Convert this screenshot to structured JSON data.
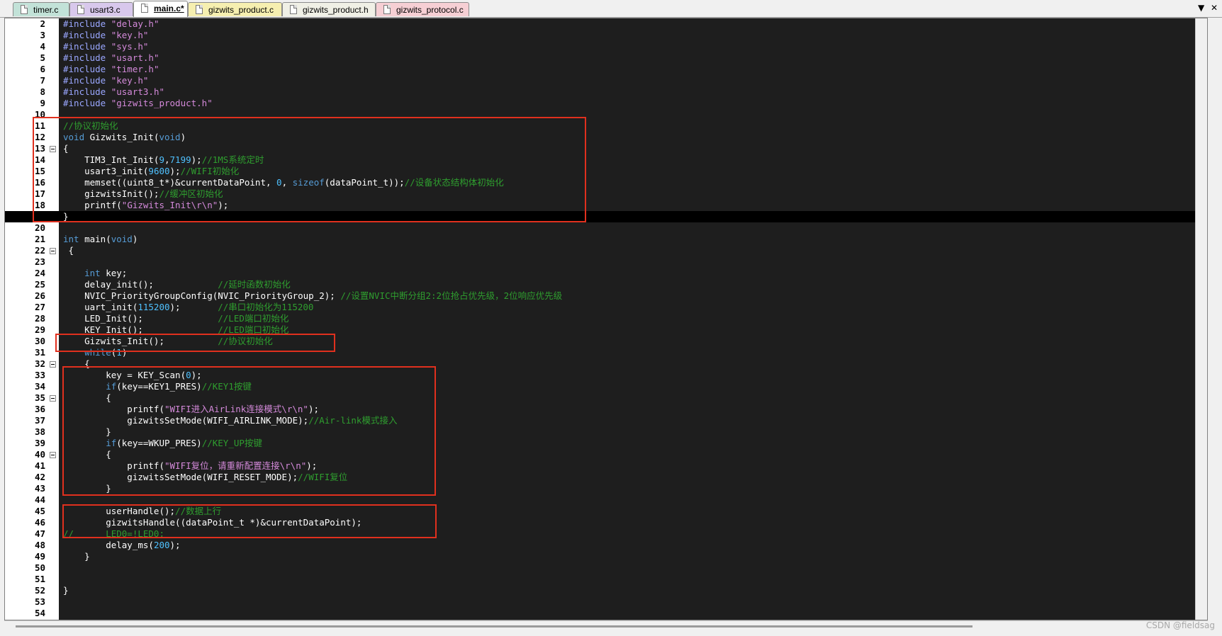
{
  "tabs": [
    {
      "label": "timer.c",
      "color": "#c2e2d8",
      "active": false
    },
    {
      "label": "usart3.c",
      "color": "#d8c8ec",
      "active": false
    },
    {
      "label": "main.c*",
      "color": "#ffffff",
      "active": true
    },
    {
      "label": "gizwits_product.c",
      "color": "#f6efb0",
      "active": false
    },
    {
      "label": "gizwits_product.h",
      "color": "#f0f0e6",
      "active": false
    },
    {
      "label": "gizwits_protocol.c",
      "color": "#f6cfd4",
      "active": false
    }
  ],
  "tab_controls": {
    "dropdown": "▼",
    "close": "✕"
  },
  "code_lines": [
    {
      "n": "2",
      "fold": false,
      "segs": [
        {
          "t": "#include ",
          "c": "pp"
        },
        {
          "t": "\"delay.h\"",
          "c": "str"
        }
      ]
    },
    {
      "n": "3",
      "fold": false,
      "segs": [
        {
          "t": "#include ",
          "c": "pp"
        },
        {
          "t": "\"key.h\"",
          "c": "str"
        }
      ]
    },
    {
      "n": "4",
      "fold": false,
      "segs": [
        {
          "t": "#include ",
          "c": "pp"
        },
        {
          "t": "\"sys.h\"",
          "c": "str"
        }
      ]
    },
    {
      "n": "5",
      "fold": false,
      "segs": [
        {
          "t": "#include ",
          "c": "pp"
        },
        {
          "t": "\"usart.h\"",
          "c": "str"
        }
      ]
    },
    {
      "n": "6",
      "fold": false,
      "segs": [
        {
          "t": "#include ",
          "c": "pp"
        },
        {
          "t": "\"timer.h\"",
          "c": "str"
        }
      ]
    },
    {
      "n": "7",
      "fold": false,
      "segs": [
        {
          "t": "#include ",
          "c": "pp"
        },
        {
          "t": "\"key.h\"",
          "c": "str"
        }
      ]
    },
    {
      "n": "8",
      "fold": false,
      "segs": [
        {
          "t": "#include ",
          "c": "pp"
        },
        {
          "t": "\"usart3.h\"",
          "c": "str"
        }
      ]
    },
    {
      "n": "9",
      "fold": false,
      "segs": [
        {
          "t": "#include ",
          "c": "pp"
        },
        {
          "t": "\"gizwits_product.h\"",
          "c": "str"
        }
      ]
    },
    {
      "n": "10",
      "fold": false,
      "segs": []
    },
    {
      "n": "11",
      "fold": false,
      "segs": [
        {
          "t": "//协议初始化",
          "c": "cmt"
        }
      ]
    },
    {
      "n": "12",
      "fold": false,
      "segs": [
        {
          "t": "void",
          "c": "kw"
        },
        {
          "t": " Gizwits_Init(",
          "c": ""
        },
        {
          "t": "void",
          "c": "kw"
        },
        {
          "t": ")",
          "c": ""
        }
      ]
    },
    {
      "n": "13",
      "fold": true,
      "segs": [
        {
          "t": "{",
          "c": ""
        }
      ]
    },
    {
      "n": "14",
      "fold": false,
      "segs": [
        {
          "t": "    TIM3_Int_Init(",
          "c": ""
        },
        {
          "t": "9",
          "c": "num"
        },
        {
          "t": ",",
          "c": ""
        },
        {
          "t": "7199",
          "c": "num"
        },
        {
          "t": ");",
          "c": ""
        },
        {
          "t": "//1MS系统定时",
          "c": "cmt"
        }
      ]
    },
    {
      "n": "15",
      "fold": false,
      "segs": [
        {
          "t": "    usart3_init(",
          "c": ""
        },
        {
          "t": "9600",
          "c": "num"
        },
        {
          "t": ");",
          "c": ""
        },
        {
          "t": "//WIFI初始化",
          "c": "cmt"
        }
      ]
    },
    {
      "n": "16",
      "fold": false,
      "segs": [
        {
          "t": "    memset((uint8_t*)&currentDataPoint, ",
          "c": ""
        },
        {
          "t": "0",
          "c": "num"
        },
        {
          "t": ", ",
          "c": ""
        },
        {
          "t": "sizeof",
          "c": "kw"
        },
        {
          "t": "(dataPoint_t));",
          "c": ""
        },
        {
          "t": "//设备状态结构体初始化",
          "c": "cmt"
        }
      ]
    },
    {
      "n": "17",
      "fold": false,
      "segs": [
        {
          "t": "    gizwitsInit();",
          "c": ""
        },
        {
          "t": "//缓冲区初始化",
          "c": "cmt"
        }
      ]
    },
    {
      "n": "18",
      "fold": false,
      "segs": [
        {
          "t": "    printf(",
          "c": ""
        },
        {
          "t": "\"Gizwits_Init\\r\\n\"",
          "c": "str"
        },
        {
          "t": ");",
          "c": ""
        }
      ]
    },
    {
      "n": "19",
      "fold": false,
      "cur": true,
      "segs": [
        {
          "t": "}",
          "c": ""
        }
      ]
    },
    {
      "n": "20",
      "fold": false,
      "segs": []
    },
    {
      "n": "21",
      "fold": false,
      "segs": [
        {
          "t": "int",
          "c": "kw"
        },
        {
          "t": " main(",
          "c": ""
        },
        {
          "t": "void",
          "c": "kw"
        },
        {
          "t": ")",
          "c": ""
        }
      ]
    },
    {
      "n": "22",
      "fold": true,
      "segs": [
        {
          "t": " {",
          "c": ""
        }
      ]
    },
    {
      "n": "23",
      "fold": false,
      "segs": []
    },
    {
      "n": "24",
      "fold": false,
      "segs": [
        {
          "t": "    ",
          "c": ""
        },
        {
          "t": "int",
          "c": "kw"
        },
        {
          "t": " key;",
          "c": ""
        }
      ]
    },
    {
      "n": "25",
      "fold": false,
      "segs": [
        {
          "t": "    delay_init();            ",
          "c": ""
        },
        {
          "t": "//延时函数初始化",
          "c": "cmt"
        }
      ]
    },
    {
      "n": "26",
      "fold": false,
      "segs": [
        {
          "t": "    NVIC_PriorityGroupConfig(NVIC_PriorityGroup_2); ",
          "c": ""
        },
        {
          "t": "//设置NVIC中断分组2:2位抢占优先级，2位响应优先级",
          "c": "cmt"
        }
      ]
    },
    {
      "n": "27",
      "fold": false,
      "segs": [
        {
          "t": "    uart_init(",
          "c": ""
        },
        {
          "t": "115200",
          "c": "num"
        },
        {
          "t": ");       ",
          "c": ""
        },
        {
          "t": "//串口初始化为115200",
          "c": "cmt"
        }
      ]
    },
    {
      "n": "28",
      "fold": false,
      "segs": [
        {
          "t": "    LED_Init();              ",
          "c": ""
        },
        {
          "t": "//LED端口初始化",
          "c": "cmt"
        }
      ]
    },
    {
      "n": "29",
      "fold": false,
      "segs": [
        {
          "t": "    KEY_Init();              ",
          "c": ""
        },
        {
          "t": "//LED端口初始化",
          "c": "cmt"
        }
      ]
    },
    {
      "n": "30",
      "fold": false,
      "segs": [
        {
          "t": "    Gizwits_Init();          ",
          "c": ""
        },
        {
          "t": "//协议初始化",
          "c": "cmt"
        }
      ]
    },
    {
      "n": "31",
      "fold": false,
      "segs": [
        {
          "t": "    ",
          "c": ""
        },
        {
          "t": "while",
          "c": "kw"
        },
        {
          "t": "(",
          "c": ""
        },
        {
          "t": "1",
          "c": "num"
        },
        {
          "t": ")",
          "c": ""
        }
      ]
    },
    {
      "n": "32",
      "fold": true,
      "segs": [
        {
          "t": "    {",
          "c": ""
        }
      ]
    },
    {
      "n": "33",
      "fold": false,
      "segs": [
        {
          "t": "        key = KEY_Scan(",
          "c": ""
        },
        {
          "t": "0",
          "c": "num"
        },
        {
          "t": ");",
          "c": ""
        }
      ]
    },
    {
      "n": "34",
      "fold": false,
      "segs": [
        {
          "t": "        ",
          "c": ""
        },
        {
          "t": "if",
          "c": "kw"
        },
        {
          "t": "(key==KEY1_PRES)",
          "c": ""
        },
        {
          "t": "//KEY1按键",
          "c": "cmt"
        }
      ]
    },
    {
      "n": "35",
      "fold": true,
      "segs": [
        {
          "t": "        {",
          "c": ""
        }
      ]
    },
    {
      "n": "36",
      "fold": false,
      "segs": [
        {
          "t": "            printf(",
          "c": ""
        },
        {
          "t": "\"WIFI进入AirLink连接模式\\r\\n\"",
          "c": "str"
        },
        {
          "t": ");",
          "c": ""
        }
      ]
    },
    {
      "n": "37",
      "fold": false,
      "segs": [
        {
          "t": "            gizwitsSetMode(WIFI_AIRLINK_MODE);",
          "c": ""
        },
        {
          "t": "//Air-link模式接入",
          "c": "cmt"
        }
      ]
    },
    {
      "n": "38",
      "fold": false,
      "segs": [
        {
          "t": "        }",
          "c": ""
        }
      ]
    },
    {
      "n": "39",
      "fold": false,
      "segs": [
        {
          "t": "        ",
          "c": ""
        },
        {
          "t": "if",
          "c": "kw"
        },
        {
          "t": "(key==WKUP_PRES)",
          "c": ""
        },
        {
          "t": "//KEY_UP按键",
          "c": "cmt"
        }
      ]
    },
    {
      "n": "40",
      "fold": true,
      "segs": [
        {
          "t": "        {",
          "c": ""
        }
      ]
    },
    {
      "n": "41",
      "fold": false,
      "segs": [
        {
          "t": "            printf(",
          "c": ""
        },
        {
          "t": "\"WIFI复位，请重新配置连接\\r\\n\"",
          "c": "str"
        },
        {
          "t": ");",
          "c": ""
        }
      ]
    },
    {
      "n": "42",
      "fold": false,
      "segs": [
        {
          "t": "            gizwitsSetMode(WIFI_RESET_MODE);",
          "c": ""
        },
        {
          "t": "//WIFI复位",
          "c": "cmt"
        }
      ]
    },
    {
      "n": "43",
      "fold": false,
      "segs": [
        {
          "t": "        }",
          "c": ""
        }
      ]
    },
    {
      "n": "44",
      "fold": false,
      "segs": []
    },
    {
      "n": "45",
      "fold": false,
      "segs": [
        {
          "t": "        userHandle();",
          "c": ""
        },
        {
          "t": "//数据上行",
          "c": "cmt"
        }
      ]
    },
    {
      "n": "46",
      "fold": false,
      "segs": [
        {
          "t": "        gizwitsHandle((dataPoint_t *)&currentDataPoint);",
          "c": ""
        }
      ]
    },
    {
      "n": "47",
      "fold": false,
      "segs": [
        {
          "t": "//      LED0=!LED0;",
          "c": "cmt"
        }
      ]
    },
    {
      "n": "48",
      "fold": false,
      "segs": [
        {
          "t": "        delay_ms(",
          "c": ""
        },
        {
          "t": "200",
          "c": "num"
        },
        {
          "t": ");",
          "c": ""
        }
      ]
    },
    {
      "n": "49",
      "fold": false,
      "segs": [
        {
          "t": "    }",
          "c": ""
        }
      ]
    },
    {
      "n": "50",
      "fold": false,
      "segs": []
    },
    {
      "n": "51",
      "fold": false,
      "segs": []
    },
    {
      "n": "52",
      "fold": false,
      "segs": [
        {
          "t": "}",
          "c": ""
        }
      ]
    },
    {
      "n": "53",
      "fold": false,
      "segs": []
    },
    {
      "n": "54",
      "fold": false,
      "segs": []
    }
  ],
  "watermark": "CSDN @fieldsag"
}
